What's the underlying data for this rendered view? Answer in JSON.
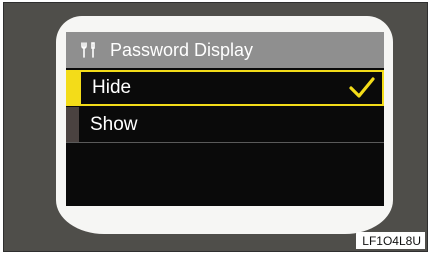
{
  "screen": {
    "title": "Password Display",
    "title_icon": "wrench-screwdriver-icon"
  },
  "menu": {
    "items": [
      {
        "label": "Hide",
        "selected": true,
        "checked": true
      },
      {
        "label": "Show",
        "selected": false,
        "checked": false
      }
    ]
  },
  "figure_code": "LF1O4L8U",
  "colors": {
    "highlight": "#f3dc19",
    "title_bar": "#8f8f8f",
    "screen_bg": "#0a0a0a",
    "bezel": "#f6f6f4",
    "frame": "#4f4e4a"
  }
}
